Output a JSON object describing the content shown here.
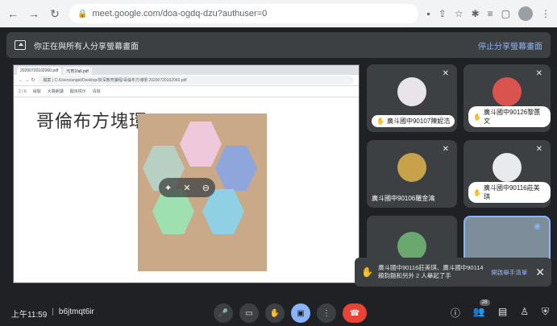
{
  "browser": {
    "url": "meet.google.com/doa-ogdq-dzu?authuser=0"
  },
  "banner": {
    "text": "你正在與所有人分享螢幕畫面",
    "stop_label": "停止分享螢幕畫面"
  },
  "shared_screen": {
    "tabs": [
      "20200720102060.pdf",
      "元宵1fall.pdf"
    ],
    "url": "檔案 | C:/Users/angel/Desktop/資深教育課程/哥倫布方塊環 20200720102060.pdf",
    "toolbar": [
      "2 / 6",
      "繪製",
      "大聲朗讀",
      "醒目標示",
      "清除"
    ],
    "pdf_title": "哥倫布方塊環"
  },
  "tiles": [
    {
      "name": "廣斗國中90107陳妮浩",
      "hand": true
    },
    {
      "name": "廣斗國中90126黎蕙文",
      "hand": true
    },
    {
      "name": "廣斗國中90106羅金鴻",
      "hand": false
    },
    {
      "name": "廣斗國中90116莊美琪",
      "hand": true
    },
    {
      "name": "",
      "hand": false
    },
    {
      "name": "",
      "hand": false
    }
  ],
  "toast": {
    "message": "廣斗國中90116莊美琪、廣斗國中90114賴鈞鎧和另外 2 人舉起了手",
    "action": "開啟舉手清單"
  },
  "meeting": {
    "time": "上午11:59",
    "code": "b6jtmqt6ir",
    "participants_count": "28"
  },
  "colors": {
    "meet_bg": "#202124",
    "accent_blue": "#8ab4f8",
    "end_call_red": "#ea4335"
  }
}
